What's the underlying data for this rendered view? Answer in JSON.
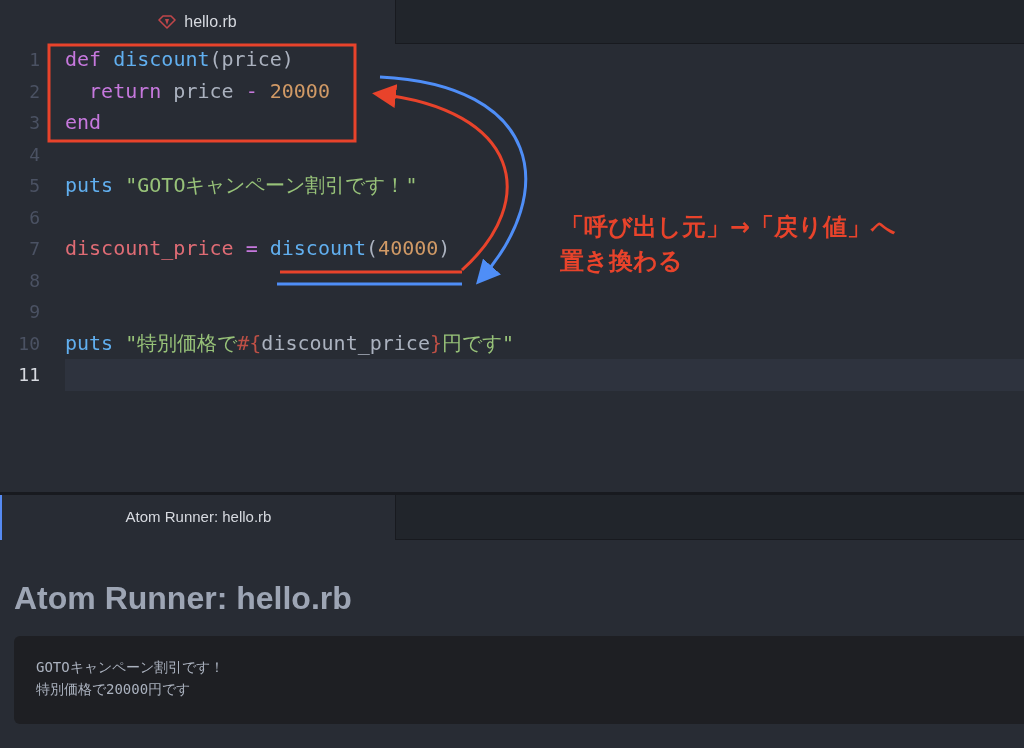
{
  "editor": {
    "tabs": [
      {
        "label": "hello.rb",
        "selected": true
      }
    ],
    "lines": [
      {
        "number": "1",
        "current": false,
        "tokens": [
          {
            "kind": "keyword",
            "text": "def "
          },
          {
            "kind": "function",
            "text": "discount"
          },
          {
            "kind": "plain",
            "text": "(price)"
          }
        ]
      },
      {
        "number": "2",
        "current": false,
        "tokens": [
          {
            "kind": "keyword",
            "text": "  return"
          },
          {
            "kind": "plain",
            "text": " price "
          },
          {
            "kind": "keyword",
            "text": "- "
          },
          {
            "kind": "number",
            "text": "20000"
          }
        ]
      },
      {
        "number": "3",
        "current": false,
        "tokens": [
          {
            "kind": "keyword",
            "text": "end"
          }
        ]
      },
      {
        "number": "4",
        "current": false
      },
      {
        "number": "5",
        "current": false,
        "tokens": [
          {
            "kind": "function",
            "text": "puts "
          },
          {
            "kind": "string",
            "text": "\"GOTOキャンペーン割引です！\""
          }
        ]
      },
      {
        "number": "6",
        "current": false
      },
      {
        "number": "7",
        "current": false,
        "tokens": [
          {
            "kind": "variable",
            "text": "discount_price "
          },
          {
            "kind": "keyword",
            "text": "= "
          },
          {
            "kind": "function",
            "text": "discount"
          },
          {
            "kind": "plain",
            "text": "("
          },
          {
            "kind": "number",
            "text": "40000"
          },
          {
            "kind": "plain",
            "text": ")"
          }
        ]
      },
      {
        "number": "8",
        "current": false
      },
      {
        "number": "9",
        "current": false
      },
      {
        "number": "10",
        "current": false,
        "tokens": [
          {
            "kind": "function",
            "text": "puts "
          },
          {
            "kind": "string",
            "text": "\"特別価格で"
          },
          {
            "kind": "interp",
            "text": "#{"
          },
          {
            "kind": "plain",
            "text": "discount_price"
          },
          {
            "kind": "interp",
            "text": "}"
          },
          {
            "kind": "string",
            "text": "円です\""
          }
        ]
      },
      {
        "number": "11",
        "current": true
      }
    ]
  },
  "annotation": {
    "lines": [
      "「呼び出し元」→「戻り値」へ",
      "置き換わる"
    ]
  },
  "runner": {
    "tabs": [
      {
        "label": "Atom Runner: hello.rb",
        "selected": true
      }
    ],
    "heading": "Atom Runner: hello.rb",
    "output": [
      "GOTOキャンペーン割引です！",
      "特別価格で20000円です"
    ]
  }
}
